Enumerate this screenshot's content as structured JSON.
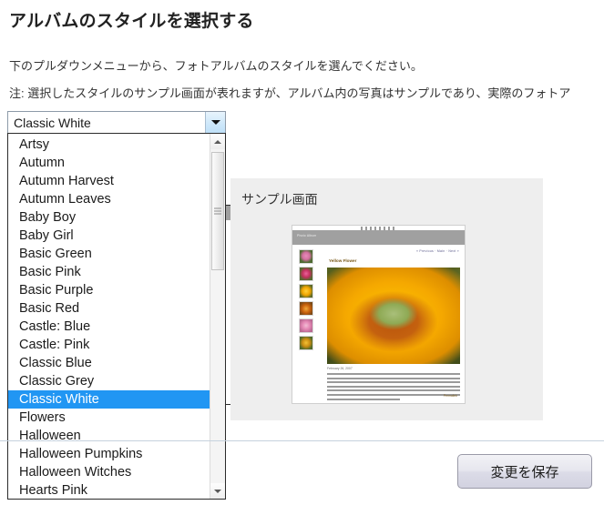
{
  "page": {
    "title": "アルバムのスタイルを選択する",
    "intro_line_1": "下のプルダウンメニューから、フォトアルバムのスタイルを選んでください。",
    "intro_line_2": "注: 選択したスタイルのサンプル画面が表れますが、アルバム内の写真はサンプルであり、実際のフォトア"
  },
  "style_select": {
    "selected_value": "Classic White",
    "arrow_icon": "chevron-down-icon",
    "options": [
      "Artsy",
      "Autumn",
      "Autumn Harvest",
      "Autumn Leaves",
      "Baby Boy",
      "Baby Girl",
      "Basic Green",
      "Basic Pink",
      "Basic Purple",
      "Basic Red",
      "Castle: Blue",
      "Castle: Pink",
      "Classic Blue",
      "Classic Grey",
      "Classic White",
      "Flowers",
      "Halloween",
      "Halloween Pumpkins",
      "Halloween Witches",
      "Hearts Pink"
    ],
    "scrollbar": {
      "up_icon": "scroll-up-arrow-icon",
      "down_icon": "scroll-down-arrow-icon"
    }
  },
  "sample_panel": {
    "title": "サンプル画面",
    "album_preview": {
      "header_text": "Photo Album",
      "nav_links": "« Previous · Main · Next »",
      "photo_title": "Yellow Flower",
      "photo_date": "February 26, 2007",
      "footer_link": "Permalink",
      "thumbnail_count": 6
    }
  },
  "footer": {
    "save_label": "変更を保存"
  },
  "colors": {
    "selection_blue": "#2196f3",
    "panel_gray": "#eeeeee",
    "divider": "#c6d2de"
  }
}
